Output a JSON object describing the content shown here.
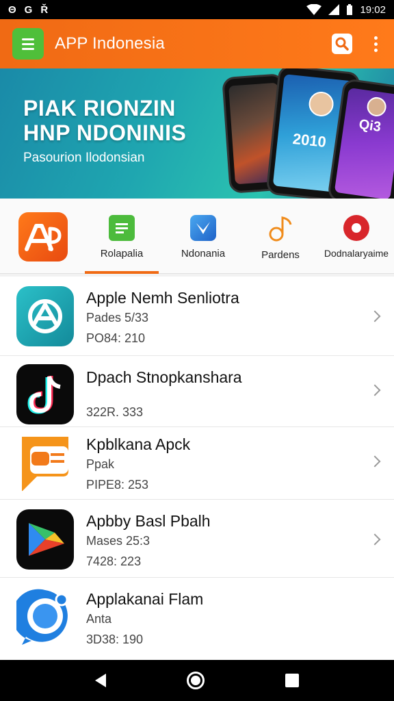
{
  "status_bar": {
    "left_icons": [
      "sync-icon",
      "sync-icon",
      "notification-icon"
    ],
    "left_glyphs": [
      "Θ",
      "G",
      "Ř"
    ],
    "time": "19:02"
  },
  "app_bar": {
    "title": "APP Indonesia",
    "accent": "#f06a14",
    "menu_color": "#4fbf3a"
  },
  "banner": {
    "title": "PIAK RIONZIN\nHNP NDONINIS",
    "subtitle": "Pasourion Ilodonsian",
    "phone_screen_text": [
      "2010",
      "Qi3"
    ]
  },
  "categories": [
    {
      "label": "",
      "icon": "ap-logo-icon",
      "color": "#f25a1a"
    },
    {
      "label": "Rolapalia",
      "icon": "document-icon",
      "color": "#4cbb3c",
      "selected": true
    },
    {
      "label": "Ndonania",
      "icon": "send-icon",
      "color": "#2f7fe0"
    },
    {
      "label": "Pardens",
      "icon": "music-note-icon",
      "color": "#f08c1c"
    },
    {
      "label": "Dodnalaryaime",
      "icon": "record-icon",
      "color": "#d8262b"
    }
  ],
  "apps": [
    {
      "title": "Apple Nemh Senliotra",
      "subtitle": "Pades 5/33",
      "meta": "PO84: 210",
      "icon": "share-swirl-icon"
    },
    {
      "title": "Dpach Stnopkanshara",
      "subtitle": "",
      "meta": "322R. 333",
      "icon": "music-note-icon"
    },
    {
      "title": "Kpblkana Apck",
      "subtitle": "Ppak",
      "meta": "PIPE8: 253",
      "icon": "chat-card-icon"
    },
    {
      "title": "Apbby Basl Pbalh",
      "subtitle": "Mases 25:3",
      "meta": "7428: 223",
      "icon": "play-triangle-icon"
    },
    {
      "title": "Applakanai Flam",
      "subtitle": "Anta",
      "meta": "3D38: 190",
      "icon": "chat-bubble-icon"
    }
  ]
}
